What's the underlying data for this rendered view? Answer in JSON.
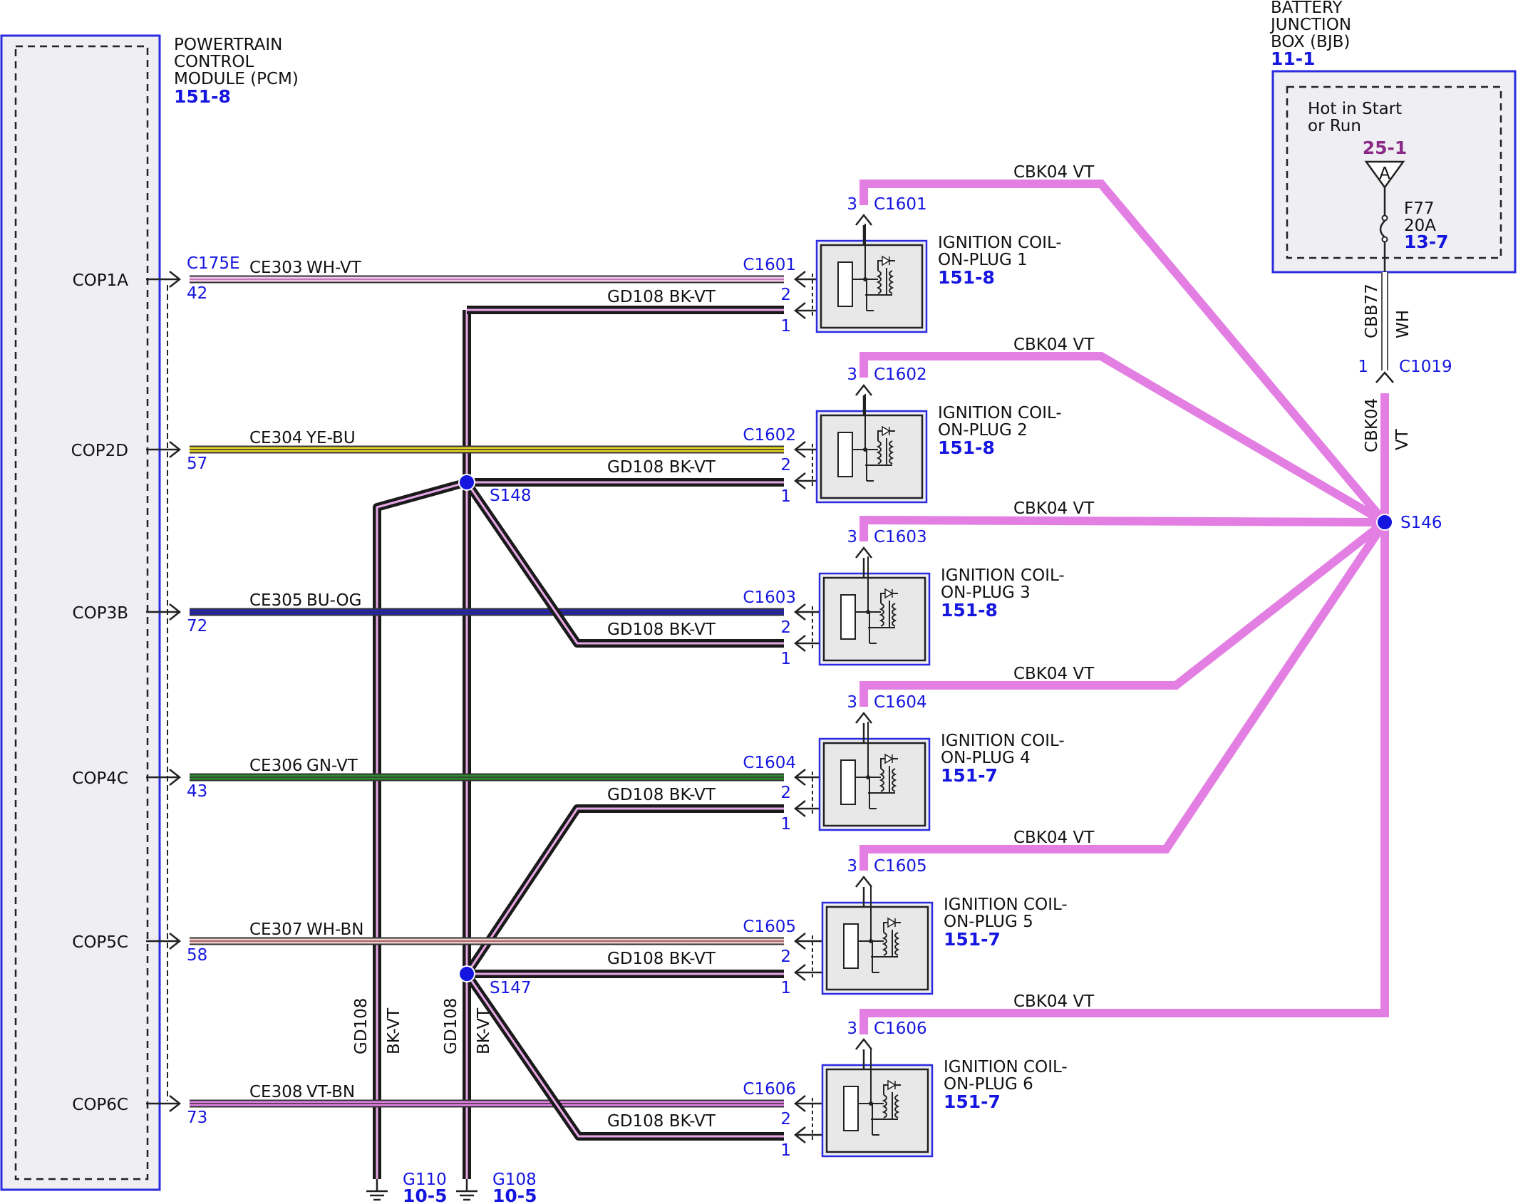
{
  "colors": {
    "ref_blue": "#1515e0",
    "module_border": "#2b2be0",
    "module_fill": "#eeeef3",
    "power_wire": "#e37ee3",
    "ground_wire_outer": "#1a1a1a",
    "ground_wire_inner": "#e8a8e8",
    "ce303": "#f0c8e8",
    "ce304": "#e4d420",
    "ce305": "#2222c8",
    "ce306": "#2e8a2e",
    "ce307": "#e8d0d0",
    "ce308": "#e37ee3",
    "bjb_ref": "#8b2a86"
  },
  "pcm": {
    "name_lines": [
      "POWERTRAIN",
      "CONTROL",
      "MODULE (PCM)"
    ],
    "ref": "151-8",
    "connector": "C175E"
  },
  "bjb": {
    "name_lines": [
      "BATTERY",
      "JUNCTION",
      "BOX (BJB)"
    ],
    "ref": "11-1",
    "hot_lines": [
      "Hot in Start",
      "or Run"
    ],
    "feed_ref": "25-1",
    "feed_pin": "A",
    "fuse_name": "F77",
    "fuse_rating": "20A",
    "fuse_ref": "13-7"
  },
  "feed_wire": {
    "circuit": "CBB77",
    "color": "WH",
    "connector": "C1019",
    "pin": "1",
    "out_circuit": "CBK04",
    "out_color": "VT",
    "splice": "S146"
  },
  "coils": [
    {
      "signal": "COP1A",
      "pcm_pin": "42",
      "circuit": "CE303",
      "wire_color": "WH-VT",
      "connector": "C1601",
      "name_lines": [
        "IGNITION COIL-",
        "ON-PLUG 1"
      ],
      "ref": "151-8",
      "pin_power": "3",
      "pin_signal": "2",
      "pin_ground": "1",
      "power_label": "CBK04  VT",
      "ground_label": "GD108  BK-VT"
    },
    {
      "signal": "COP2D",
      "pcm_pin": "57",
      "circuit": "CE304",
      "wire_color": "YE-BU",
      "connector": "C1602",
      "name_lines": [
        "IGNITION COIL-",
        "ON-PLUG 2"
      ],
      "ref": "151-8",
      "pin_power": "3",
      "pin_signal": "2",
      "pin_ground": "1",
      "power_label": "CBK04  VT",
      "ground_label": "GD108  BK-VT"
    },
    {
      "signal": "COP3B",
      "pcm_pin": "72",
      "circuit": "CE305",
      "wire_color": "BU-OG",
      "connector": "C1603",
      "name_lines": [
        "IGNITION COIL-",
        "ON-PLUG 3"
      ],
      "ref": "151-8",
      "pin_power": "3",
      "pin_signal": "2",
      "pin_ground": "1",
      "power_label": "CBK04  VT",
      "ground_label": "GD108  BK-VT"
    },
    {
      "signal": "COP4C",
      "pcm_pin": "43",
      "circuit": "CE306",
      "wire_color": "GN-VT",
      "connector": "C1604",
      "name_lines": [
        "IGNITION COIL-",
        "ON-PLUG 4"
      ],
      "ref": "151-7",
      "pin_power": "3",
      "pin_signal": "2",
      "pin_ground": "1",
      "power_label": "CBK04  VT",
      "ground_label": "GD108  BK-VT"
    },
    {
      "signal": "COP5C",
      "pcm_pin": "58",
      "circuit": "CE307",
      "wire_color": "WH-BN",
      "connector": "C1605",
      "name_lines": [
        "IGNITION COIL-",
        "ON-PLUG 5"
      ],
      "ref": "151-7",
      "pin_power": "3",
      "pin_signal": "2",
      "pin_ground": "1",
      "power_label": "CBK04  VT",
      "ground_label": "GD108  BK-VT"
    },
    {
      "signal": "COP6C",
      "pcm_pin": "73",
      "circuit": "CE308",
      "wire_color": "VT-BN",
      "connector": "C1606",
      "name_lines": [
        "IGNITION COIL-",
        "ON-PLUG 6"
      ],
      "ref": "151-7",
      "pin_power": "3",
      "pin_signal": "2",
      "pin_ground": "1",
      "power_label": "CBK04  VT",
      "ground_label": "GD108  BK-VT"
    }
  ],
  "splices": {
    "upper": "S148",
    "lower": "S147"
  },
  "grounds": [
    {
      "id": "G110",
      "ref": "10-5",
      "circuit": "GD108",
      "color": "BK-VT"
    },
    {
      "id": "G108",
      "ref": "10-5",
      "circuit": "GD108",
      "color": "BK-VT"
    }
  ]
}
